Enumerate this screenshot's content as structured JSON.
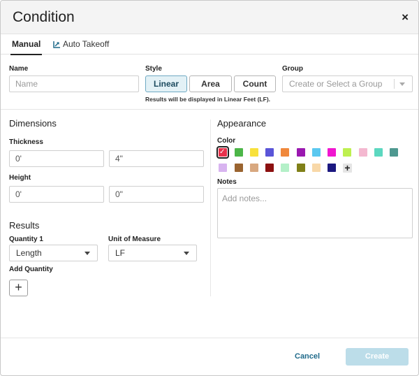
{
  "dialog": {
    "title": "Condition",
    "close_glyph": "×"
  },
  "tabs": [
    {
      "label": "Manual",
      "active": true
    },
    {
      "label": "Auto Takeoff",
      "icon": "auto-takeoff-icon",
      "active": false
    }
  ],
  "name": {
    "label": "Name",
    "placeholder": "Name",
    "value": ""
  },
  "style": {
    "label": "Style",
    "options": [
      "Linear",
      "Area",
      "Count"
    ],
    "selected": "Linear",
    "hint": "Results will be displayed in Linear Feet (LF)."
  },
  "group": {
    "label": "Group",
    "placeholder": "Create or Select a Group"
  },
  "dimensions": {
    "title": "Dimensions",
    "thickness": {
      "label": "Thickness",
      "feet": "0'",
      "inches": "4\""
    },
    "height": {
      "label": "Height",
      "feet": "0'",
      "inches": "0\""
    }
  },
  "results": {
    "title": "Results",
    "quantity1": {
      "label": "Quantity 1",
      "value": "Length"
    },
    "unit": {
      "label": "Unit of Measure",
      "value": "LF"
    },
    "add_quantity": {
      "label": "Add Quantity",
      "button": "+"
    }
  },
  "appearance": {
    "title": "Appearance",
    "color_label": "Color",
    "selected_color": "#e8324c",
    "colors": [
      "#e8324c",
      "#4cb648",
      "#f8e13c",
      "#5a55d8",
      "#f0883c",
      "#9a18b0",
      "#5bc8f0",
      "#f016d0",
      "#bef050",
      "#f4b8d0",
      "#5cd8c0",
      "#4e9890",
      "#d8b4f0",
      "#9a6430",
      "#d8a880",
      "#8c1010",
      "#b4f0c8",
      "#808018",
      "#f8d8a8",
      "#1c1880"
    ],
    "add_color_glyph": "+",
    "notes_label": "Notes",
    "notes_placeholder": "Add notes..."
  },
  "footer": {
    "cancel": "Cancel",
    "create": "Create"
  },
  "colors": {
    "accent": "#1f6a8a",
    "create_disabled": "#bcdde9",
    "linear_active_bg": "#e3f1f6"
  }
}
